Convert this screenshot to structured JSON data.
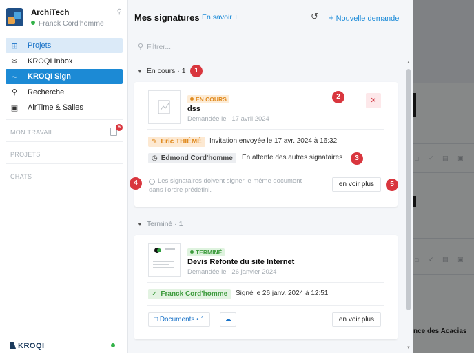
{
  "workspace": {
    "name": "ArchiTech",
    "user": "Franck Cord'homme"
  },
  "nav": [
    {
      "label": "Projets",
      "icon": "grid-icon"
    },
    {
      "label": "KROQI Inbox",
      "icon": "inbox-icon"
    },
    {
      "label": "KROQI Sign",
      "icon": "signature-icon"
    },
    {
      "label": "Recherche",
      "icon": "search-icon"
    },
    {
      "label": "AirTime & Salles",
      "icon": "video-icon"
    }
  ],
  "sections": [
    {
      "label": "MON TRAVAIL",
      "badge": "6"
    },
    {
      "label": "PROJETS"
    },
    {
      "label": "CHATS"
    }
  ],
  "brand": "KROQI",
  "header": {
    "title": "Mes signatures",
    "learn_more": "En savoir +",
    "new_request": "Nouvelle demande"
  },
  "filter": {
    "placeholder": "Filtrer..."
  },
  "groups": {
    "in_progress": "En cours · 1",
    "done": "Terminé · 1"
  },
  "card1": {
    "status": "EN COURS",
    "name": "dss",
    "date": "Demandée le : 17 avril 2024",
    "sender": "Eric THIÉMÉ",
    "sender_text": "Invitation envoyée le 17 avr. 2024 à 16:32",
    "signer": "Edmond Cord'homme",
    "signer_text": "En attente des autres signataires",
    "info_line1": "Les signataires doivent signer le même document",
    "info_line2": "dans l'ordre prédéfini.",
    "more": "en voir plus"
  },
  "card2": {
    "status": "TERMINÉ",
    "name": "Devis Refonte du site Internet",
    "date": "Demandée le : 26 janvier 2024",
    "signer": "Franck Cord'homme",
    "signer_text": "Signé le 26 janv. 2024 à 12:51",
    "documents": "Documents • 1",
    "more": "en voir plus"
  },
  "callouts": [
    "1",
    "2",
    "3",
    "4",
    "5"
  ],
  "background": {
    "partial_text": "nce des Acacias"
  },
  "colors": {
    "accent": "#1c8ad5",
    "callout": "#d9363e",
    "in_progress": "#e08a1e",
    "done": "#3d9b3d"
  }
}
